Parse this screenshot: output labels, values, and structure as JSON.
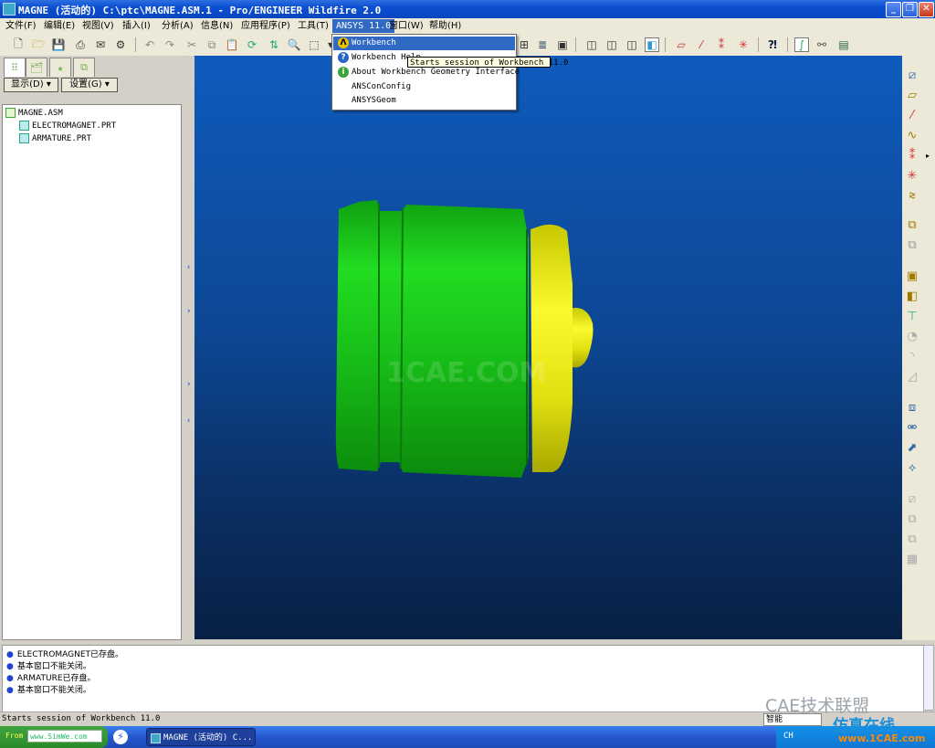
{
  "window": {
    "title": "MAGNE (活动的) C:\\ptc\\MAGNE.ASM.1 - Pro/ENGINEER Wildfire 2.0",
    "minimize": "_",
    "maximize": "❐",
    "close": "✕"
  },
  "menubar": [
    "文件(F)",
    "编辑(E)",
    "视图(V)",
    "插入(I)",
    "分析(A)",
    "信息(N)",
    "应用程序(P)",
    "工具(T)",
    "ANSYS 11.0",
    "窗口(W)",
    "帮助(H)"
  ],
  "ansys_menu": {
    "items": [
      "Workbench",
      "Workbench Help",
      "About Workbench Geometry Interface",
      "ANSConConfig",
      "ANSYSGeom"
    ],
    "tooltip": "Starts session of Workbench 11.0"
  },
  "model_tree": {
    "show_label": "显示(D) ▾",
    "settings_label": "设置(G) ▾",
    "root": "MAGNE.ASM",
    "children": [
      "ELECTROMAGNET.PRT",
      "ARMATURE.PRT"
    ]
  },
  "viewport": {
    "watermark": "1CAE.COM",
    "colors": {
      "body": "#18d018",
      "armature": "#f0f020"
    }
  },
  "messages": [
    "ELECTROMAGNET已存盘。",
    "基本窗口不能关闭。",
    "ARMATURE已存盘。",
    "基本窗口不能关闭。"
  ],
  "status": {
    "text": "Starts session of Workbench 11.0",
    "filter": "智能"
  },
  "taskbar": {
    "start_label": "From",
    "start_url": "www.SimWe.com",
    "task": "MAGNE (活动的) C...",
    "tray_lang": "CH"
  },
  "branding": {
    "cae": "CAE技术联盟",
    "cn": "仿真在线",
    "url": "www.1CAE.com"
  }
}
